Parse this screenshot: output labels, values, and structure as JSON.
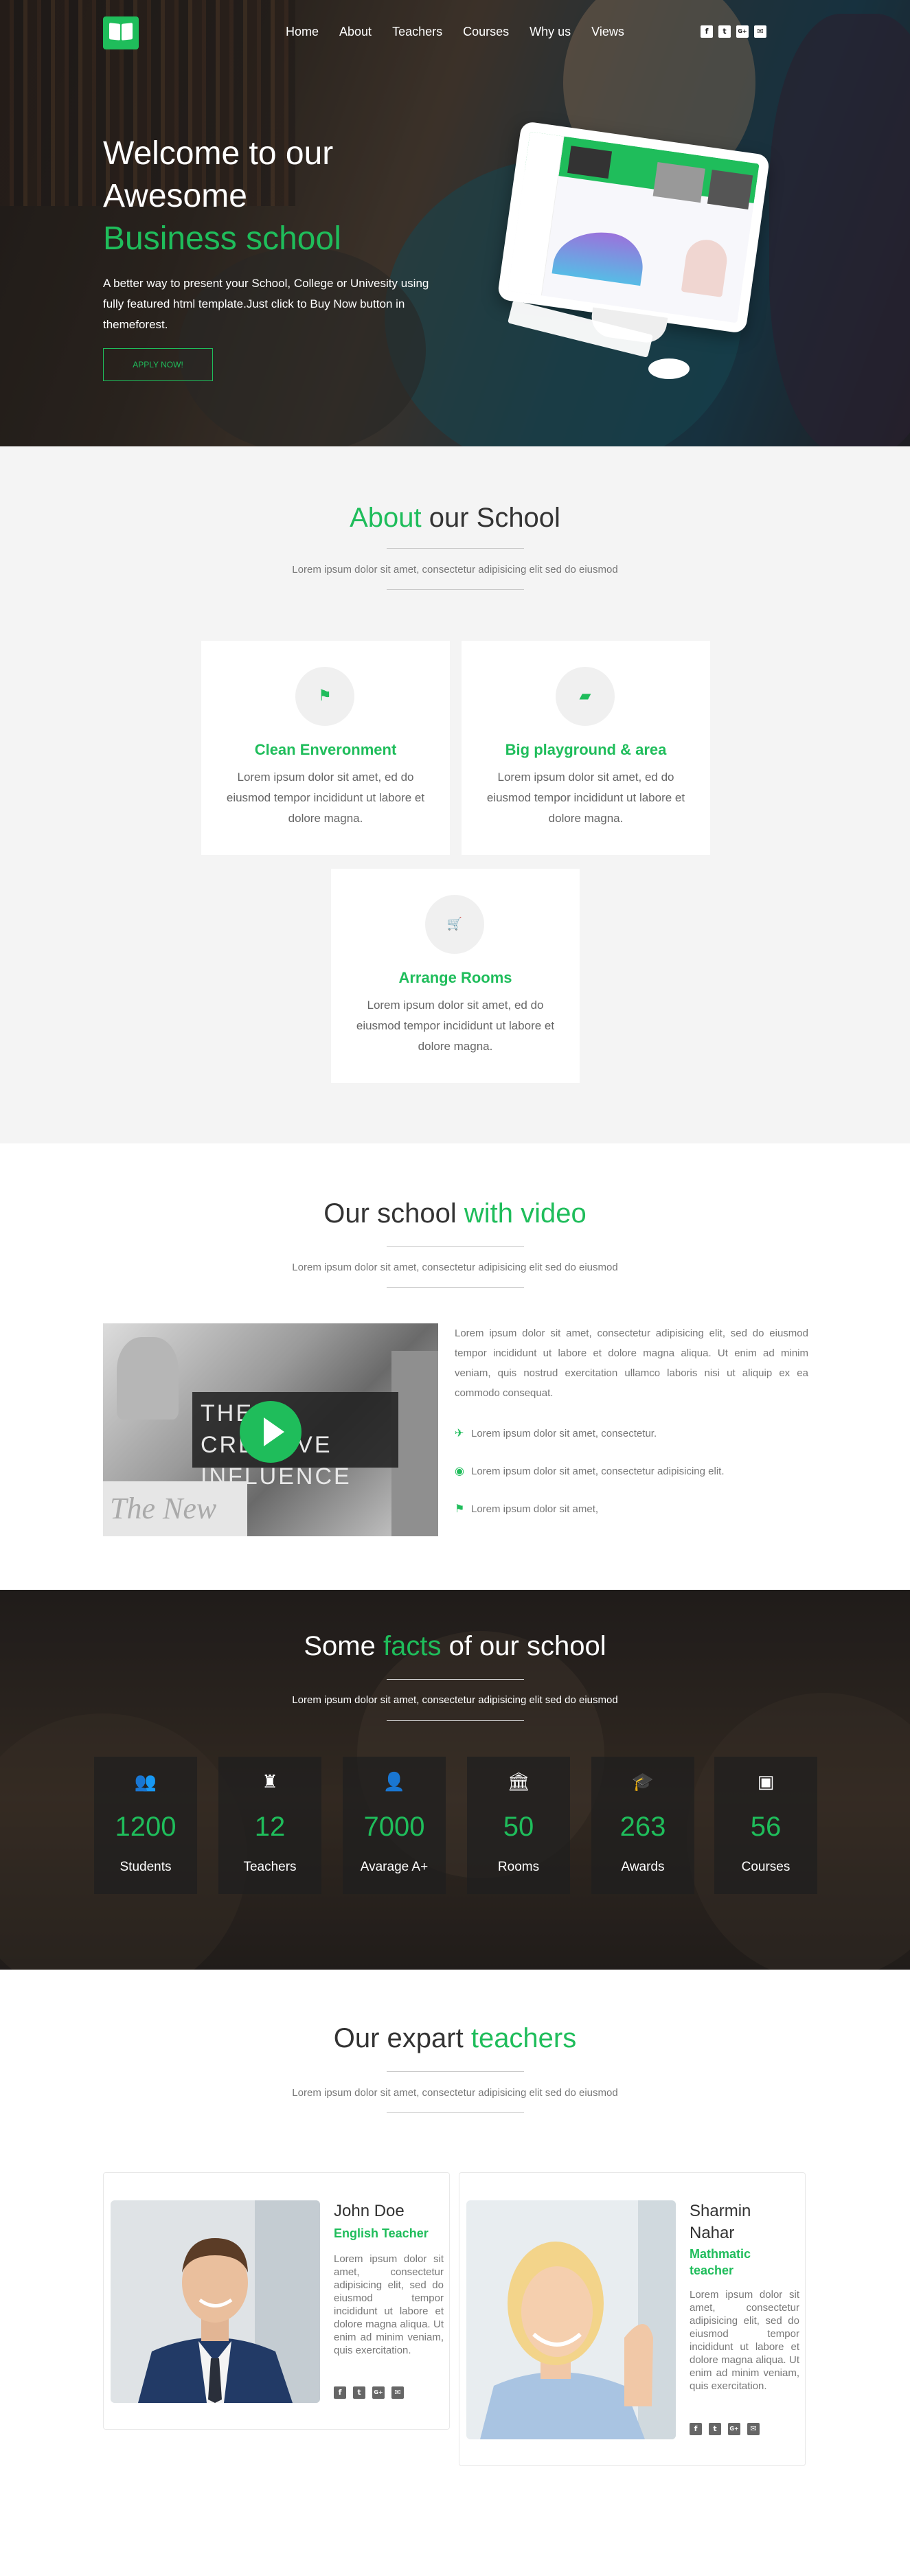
{
  "nav": {
    "items": [
      "Home",
      "About",
      "Teachers",
      "Courses",
      "Why us",
      "Views"
    ],
    "social": [
      {
        "icon": "facebook-icon",
        "glyph": "f"
      },
      {
        "icon": "twitter-icon",
        "glyph": "t"
      },
      {
        "icon": "google-plus-icon",
        "glyph": "G+"
      },
      {
        "icon": "envelope-icon",
        "glyph": "✉"
      }
    ]
  },
  "hero": {
    "line1": "Welcome to our",
    "line2": "Awesome",
    "line3": "Business school",
    "description": "A better way to present your School, College or Univesity using fully featured html template.Just click to Buy Now button in themeforest.",
    "button": "APPLY NOW!"
  },
  "about": {
    "title_accent": "About",
    "title_rest": " our School",
    "subtitle": "Lorem ipsum dolor sit amet, consectetur adipisicing elit sed do eiusmod",
    "cards": [
      {
        "icon": "flag-icon",
        "glyph": "⚑",
        "title": "Clean Enveronment",
        "text": "Lorem ipsum dolor sit amet, ed do eiusmod tempor incididunt ut labore et dolore magna."
      },
      {
        "icon": "folder-open-icon",
        "glyph": "▰",
        "title": "Big playground & area",
        "text": "Lorem ipsum dolor sit amet, ed do eiusmod tempor incididunt ut labore et dolore magna."
      },
      {
        "icon": "shopping-cart-icon",
        "glyph": "🛒",
        "title": "Arrange Rooms",
        "text": "Lorem ipsum dolor sit amet, ed do eiusmod tempor incididunt ut labore et dolore magna."
      }
    ]
  },
  "video": {
    "title_rest": "Our school ",
    "title_accent": "with video",
    "subtitle": "Lorem ipsum dolor sit amet, consectetur adipisicing elit sed do eiusmod",
    "thumbnail_text": "THE CREATIVE INFLUENCE",
    "paper_text": "The New",
    "paragraph": "Lorem ipsum dolor sit amet, consectetur adipisicing elit, sed do eiusmod tempor incididunt ut labore et dolore magna aliqua. Ut enim ad minim veniam, quis nostrud exercitation ullamco laboris nisi ut aliquip ex ea commodo consequat.",
    "items": [
      {
        "icon": "satellite-dish-icon",
        "glyph": "✈",
        "text": "Lorem ipsum dolor sit amet, consectetur."
      },
      {
        "icon": "rss-icon",
        "glyph": "◉",
        "text": "Lorem ipsum dolor sit amet, consectetur adipisicing elit."
      },
      {
        "icon": "flag-icon",
        "glyph": "⚑",
        "text": "Lorem ipsum dolor sit amet,"
      }
    ]
  },
  "facts": {
    "title_pre": "Some ",
    "title_accent": "facts",
    "title_post": " of our school",
    "subtitle": "Lorem ipsum dolor sit amet, consectetur adipisicing elit sed do eiusmod",
    "stats": [
      {
        "icon": "users-icon",
        "glyph": "👥",
        "number": "1200",
        "label": "Students"
      },
      {
        "icon": "teacher-icon",
        "glyph": "♜",
        "number": "12",
        "label": "Teachers"
      },
      {
        "icon": "user-plus-icon",
        "glyph": "👤",
        "number": "7000",
        "label": "Avarage A+"
      },
      {
        "icon": "building-icon",
        "glyph": "🏛",
        "number": "50",
        "label": "Rooms"
      },
      {
        "icon": "graduation-cap-icon",
        "glyph": "🎓",
        "number": "263",
        "label": "Awards"
      },
      {
        "icon": "briefcase-icon",
        "glyph": "▣",
        "number": "56",
        "label": "Courses"
      }
    ]
  },
  "teachers": {
    "title_rest": "Our expart ",
    "title_accent": "teachers",
    "subtitle": "Lorem ipsum dolor sit amet, consectetur adipisicing elit sed do eiusmod",
    "list": [
      {
        "name": "John Doe",
        "role": "English Teacher",
        "text": "Lorem ipsum dolor sit amet, consectetur adipisicing elit, sed do eiusmod tempor incididunt ut labore et dolore magna aliqua. Ut enim ad minim veniam, quis exercitation."
      },
      {
        "name": "Sharmin Nahar",
        "role": "Mathmatic teacher",
        "text": "Lorem ipsum dolor sit amet, consectetur adipisicing elit, sed do eiusmod tempor incididunt ut labore et dolore magna aliqua. Ut enim ad minim veniam, quis exercitation."
      }
    ]
  },
  "colors": {
    "accent": "#1fbd5b",
    "section_bg": "#f4f4f4"
  }
}
